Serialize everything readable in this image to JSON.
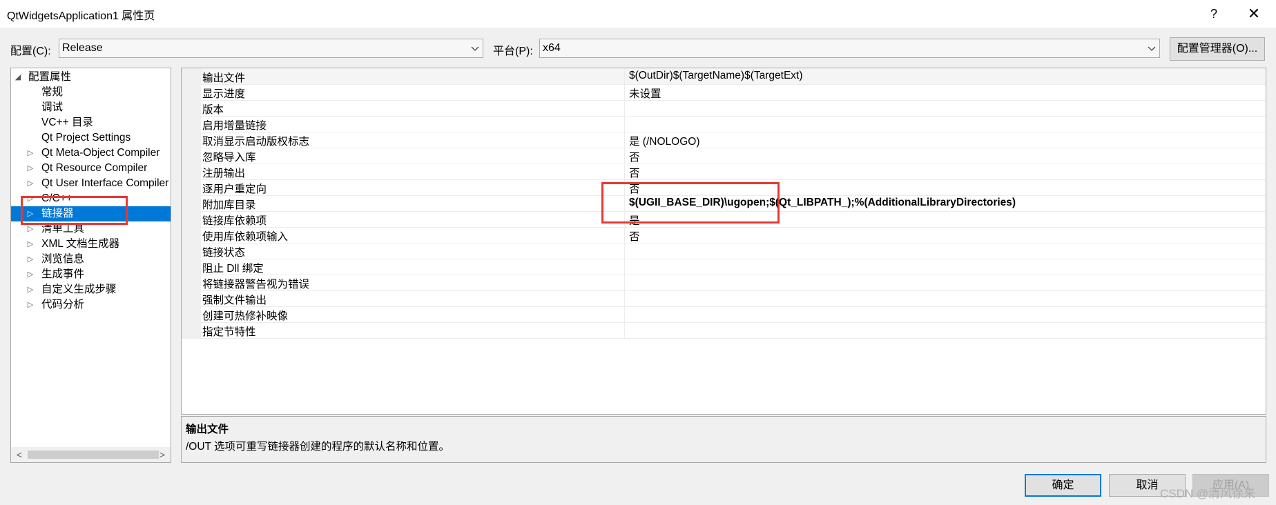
{
  "window": {
    "title": "QtWidgetsApplication1 属性页",
    "help_label": "?",
    "close_label": "✕"
  },
  "config_bar": {
    "config_label": "配置(C):",
    "config_value": "Release",
    "platform_label": "平台(P):",
    "platform_value": "x64",
    "manager_button": "配置管理器(O)..."
  },
  "tree": {
    "items": [
      {
        "label": "配置属性",
        "expander": "◢",
        "level": 0
      },
      {
        "label": "常规",
        "expander": "",
        "level": 1
      },
      {
        "label": "调试",
        "expander": "",
        "level": 1
      },
      {
        "label": "VC++ 目录",
        "expander": "",
        "level": 1
      },
      {
        "label": "Qt Project Settings",
        "expander": "",
        "level": 1
      },
      {
        "label": "Qt Meta-Object Compiler",
        "expander": "▷",
        "level": 1
      },
      {
        "label": "Qt Resource Compiler",
        "expander": "▷",
        "level": 1
      },
      {
        "label": "Qt User Interface Compiler",
        "expander": "▷",
        "level": 1
      },
      {
        "label": "C/C++",
        "expander": "▷",
        "level": 1
      },
      {
        "label": "链接器",
        "expander": "▷",
        "level": 1,
        "selected": true
      },
      {
        "label": "清单工具",
        "expander": "▷",
        "level": 1
      },
      {
        "label": "XML 文档生成器",
        "expander": "▷",
        "level": 1
      },
      {
        "label": "浏览信息",
        "expander": "▷",
        "level": 1
      },
      {
        "label": "生成事件",
        "expander": "▷",
        "level": 1
      },
      {
        "label": "自定义生成步骤",
        "expander": "▷",
        "level": 1
      },
      {
        "label": "代码分析",
        "expander": "▷",
        "level": 1
      }
    ],
    "scroll_left": "<",
    "scroll_right": ">"
  },
  "properties": [
    {
      "name": "输出文件",
      "value": "$(OutDir)$(TargetName)$(TargetExt)",
      "bold": false
    },
    {
      "name": "显示进度",
      "value": "未设置",
      "bold": false
    },
    {
      "name": "版本",
      "value": "",
      "bold": false
    },
    {
      "name": "启用增量链接",
      "value": "",
      "bold": false
    },
    {
      "name": "取消显示启动版权标志",
      "value": "是 (/NOLOGO)",
      "bold": false
    },
    {
      "name": "忽略导入库",
      "value": "否",
      "bold": false
    },
    {
      "name": "注册输出",
      "value": "否",
      "bold": false
    },
    {
      "name": "逐用户重定向",
      "value": "否",
      "bold": false
    },
    {
      "name": "附加库目录",
      "value": "$(UGII_BASE_DIR)\\ugopen;$(Qt_LIBPATH_);%(AdditionalLibraryDirectories)",
      "bold": true
    },
    {
      "name": "链接库依赖项",
      "value": "是",
      "bold": false
    },
    {
      "name": "使用库依赖项输入",
      "value": "否",
      "bold": false
    },
    {
      "name": "链接状态",
      "value": "",
      "bold": false
    },
    {
      "name": "阻止 Dll 绑定",
      "value": "",
      "bold": false
    },
    {
      "name": "将链接器警告视为错误",
      "value": "",
      "bold": false
    },
    {
      "name": "强制文件输出",
      "value": "",
      "bold": false
    },
    {
      "name": "创建可热修补映像",
      "value": "",
      "bold": false
    },
    {
      "name": "指定节特性",
      "value": "",
      "bold": false
    }
  ],
  "description": {
    "title": "输出文件",
    "text": "/OUT 选项可重写链接器创建的程序的默认名称和位置。"
  },
  "buttons": {
    "ok": "确定",
    "cancel": "取消",
    "apply": "应用(A)"
  },
  "watermark": "CSDN @清风徐来",
  "colors": {
    "selection": "#0078d7",
    "annotation": "#e53935"
  }
}
